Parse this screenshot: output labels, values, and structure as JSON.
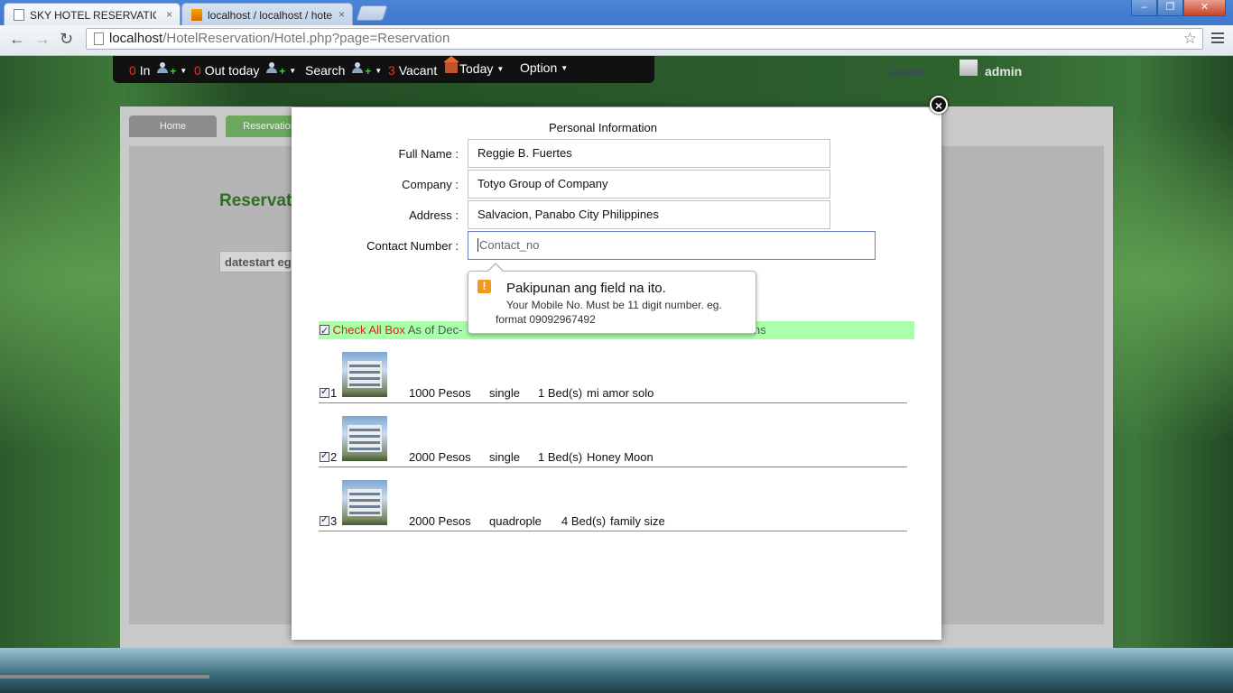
{
  "browser": {
    "tabs": [
      {
        "title": "SKY HOTEL RESERVATION",
        "close": "×"
      },
      {
        "title": "localhost / localhost / hote",
        "close": "×"
      }
    ],
    "url_host": "localhost",
    "url_path": "/HotelReservation/Hotel.php?page=Reservation"
  },
  "appnav": {
    "in_count": "0",
    "in_label": "In",
    "out_count": "0",
    "out_label": "Out today",
    "search_label": "Search",
    "vacant_count": "3",
    "vacant_label": "Vacant",
    "today_label": "Today",
    "option_label": "Option",
    "logout_label": "Logout",
    "user": "admin"
  },
  "behind": {
    "tabs": [
      "Home",
      "Reservation"
    ],
    "title": "Reservation",
    "datestart": "datestart  eg"
  },
  "modal": {
    "section_title": "Personal Information",
    "close_glyph": "×",
    "fields": [
      {
        "label": "Full Name :",
        "value": "Reggie B. Fuertes"
      },
      {
        "label": "Company :",
        "value": "Totyo Group of Company"
      },
      {
        "label": "Address :",
        "value": "Salvacion, Panabo City Philippines"
      },
      {
        "label": "Contact Number :",
        "value": "",
        "placeholder": "Contact_no"
      }
    ],
    "tooltip": {
      "title": "Pakipunan ang field na ito.",
      "body": "Your Mobile No. Must be 11 digit number. eg. format 09092967492"
    },
    "check_all_label": "Check All Box",
    "as_of": "As of Dec-",
    "bar_tail": "ns",
    "rooms": [
      {
        "no": "1",
        "price": "1000 Pesos",
        "type": "single",
        "beds": "1 Bed(s)",
        "desc": "mi amor solo"
      },
      {
        "no": "2",
        "price": "2000 Pesos",
        "type": "single",
        "beds": "1 Bed(s)",
        "desc": "Honey Moon"
      },
      {
        "no": "3",
        "price": "2000 Pesos",
        "type": "quadrople",
        "beds": "4 Bed(s)",
        "desc": "family size"
      }
    ]
  }
}
